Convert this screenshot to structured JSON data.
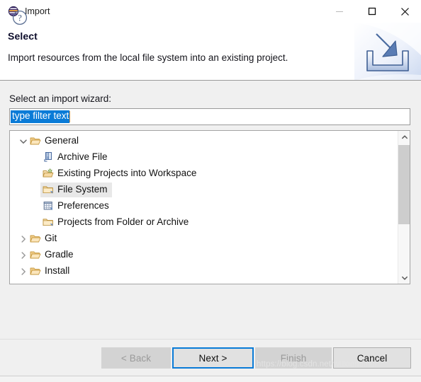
{
  "window": {
    "title": "Import",
    "app_icon": "eclipse-sphere-icon",
    "controls": {
      "minimize": "minimize-icon",
      "maximize": "maximize-icon",
      "close": "close-icon"
    }
  },
  "header": {
    "title": "Select",
    "description": "Import resources from the local file system into an existing project.",
    "graphic": "import-tray-arrow-icon"
  },
  "body": {
    "wizard_label": "Select an import wizard:",
    "filter": {
      "value": "type filter text",
      "placeholder": "type filter text",
      "selected": true
    }
  },
  "tree": {
    "selected_id": "file-system",
    "items": [
      {
        "id": "general",
        "label": "General",
        "level": 0,
        "icon": "open-folder-icon",
        "twisty": "chevron-down-icon",
        "expanded": true
      },
      {
        "id": "archive-file",
        "label": "Archive File",
        "level": 1,
        "icon": "archive-file-icon",
        "twisty": "none"
      },
      {
        "id": "existing-projects",
        "label": "Existing Projects into Workspace",
        "level": 1,
        "icon": "project-folder-icon",
        "twisty": "none"
      },
      {
        "id": "file-system",
        "label": "File System",
        "level": 1,
        "icon": "folder-icon",
        "twisty": "none"
      },
      {
        "id": "preferences",
        "label": "Preferences",
        "level": 1,
        "icon": "preferences-grid-icon",
        "twisty": "none"
      },
      {
        "id": "projects-from-folder",
        "label": "Projects from Folder or Archive",
        "level": 1,
        "icon": "folder-icon",
        "twisty": "none"
      },
      {
        "id": "git",
        "label": "Git",
        "level": 0,
        "icon": "open-folder-icon",
        "twisty": "chevron-right-icon",
        "expanded": false
      },
      {
        "id": "gradle",
        "label": "Gradle",
        "level": 0,
        "icon": "open-folder-icon",
        "twisty": "chevron-right-icon",
        "expanded": false
      },
      {
        "id": "install",
        "label": "Install",
        "level": 0,
        "icon": "open-folder-icon",
        "twisty": "chevron-right-icon",
        "expanded": false
      }
    ],
    "scrollbar": {
      "up_arrow": "chevron-up-icon",
      "down_arrow": "chevron-down-icon"
    }
  },
  "footer": {
    "help": "help-circle-icon",
    "buttons": {
      "back": {
        "label": "< Back",
        "state": "disabled"
      },
      "next": {
        "label": "Next >",
        "state": "default"
      },
      "finish": {
        "label": "Finish",
        "state": "disabled"
      },
      "cancel": {
        "label": "Cancel",
        "state": "normal"
      }
    }
  },
  "watermark": "https://blog.csdn.net/wuxiemimei",
  "colors": {
    "selection_blue": "#0a7bd7",
    "focus_blue": "#0a7bd7",
    "dialog_bg": "#f0f0f0",
    "tree_bg": "#ffffff",
    "tree_selection": "#e8e8e8",
    "folder_gold": "#e8b96a"
  }
}
